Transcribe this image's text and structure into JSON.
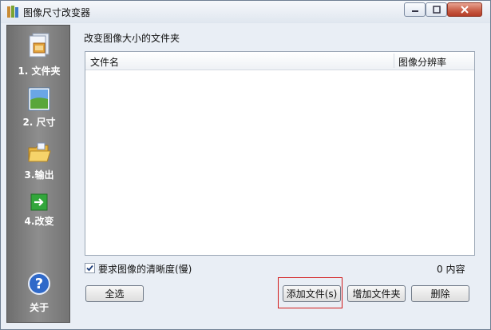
{
  "window": {
    "title": "图像尺寸改变器"
  },
  "sidebar": {
    "items": [
      {
        "label": "1. 文件夹",
        "icon": "folder-documents-icon"
      },
      {
        "label": "2. 尺寸",
        "icon": "landscape-image-icon"
      },
      {
        "label": "3.输出",
        "icon": "open-folder-icon"
      },
      {
        "label": "4.改变",
        "icon": "green-arrow-icon"
      }
    ],
    "about": {
      "label": "关于",
      "icon": "help-icon"
    }
  },
  "main": {
    "section_title": "改变图像大小的文件夹",
    "list": {
      "columns": [
        "文件名",
        "图像分辨率"
      ],
      "rows": []
    },
    "clarity_checkbox": {
      "label": "要求图像的清晰度(慢)",
      "checked": true
    },
    "count_text": "0 内容",
    "buttons": {
      "select_all": "全选",
      "add_file": "添加文件(s)",
      "add_folder": "增加文件夹",
      "delete": "删除"
    }
  },
  "colors": {
    "sidebar_bg": "#7f7f7f",
    "window_bg": "#e9eef5",
    "highlight": "#d21a1a",
    "close_button": "#c75a43"
  }
}
